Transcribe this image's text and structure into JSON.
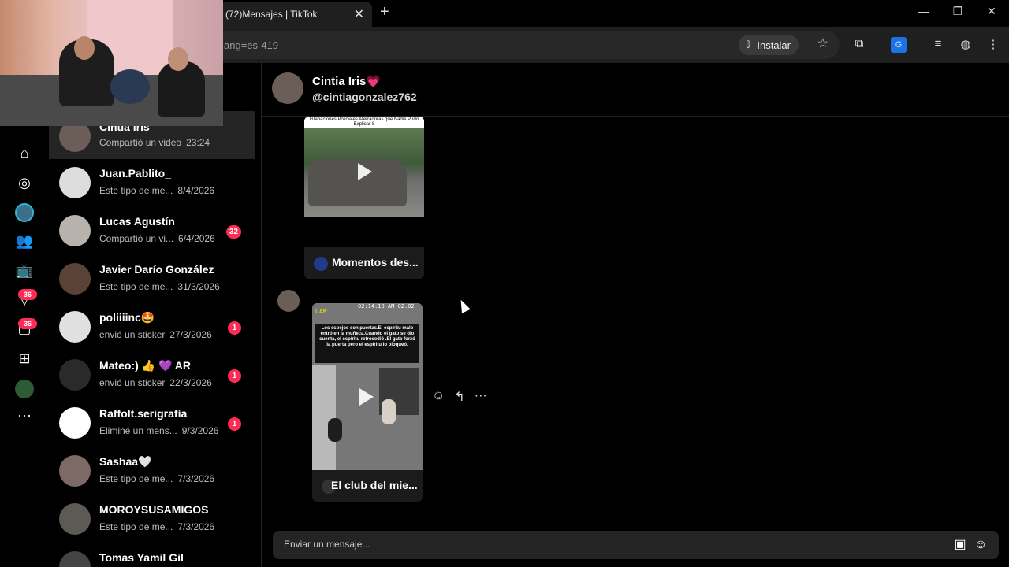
{
  "browser": {
    "tab_title": "(72)Mensajes | TikTok",
    "url": "ang=es-419",
    "install_label": "Instalar"
  },
  "rail": {
    "notifications_badge": "36",
    "messages_badge": "36"
  },
  "conversations": [
    {
      "name": "Cintia Iris",
      "preview": "Compartió un video",
      "date": "23:24",
      "unread": ""
    },
    {
      "name": "Juan.Pablito_",
      "preview": "Este tipo de me...",
      "date": "8/4/2026",
      "unread": ""
    },
    {
      "name": "Lucas Agustín",
      "preview": "Compartió un vi...",
      "date": "6/4/2026",
      "unread": "32"
    },
    {
      "name": "Javier Darío González",
      "preview": "Este tipo de me...",
      "date": "31/3/2026",
      "unread": ""
    },
    {
      "name": "poliiiinc🤩",
      "preview": "envió un sticker",
      "date": "27/3/2026",
      "unread": "1"
    },
    {
      "name": "Mateo:) 👍 💜 AR",
      "preview": "envió un sticker",
      "date": "22/3/2026",
      "unread": "1"
    },
    {
      "name": "Raffolt.serigrafía",
      "preview": "Eliminé un mens...",
      "date": "9/3/2026",
      "unread": "1"
    },
    {
      "name": "Sashaa🤍",
      "preview": "Este tipo de me...",
      "date": "7/3/2026",
      "unread": ""
    },
    {
      "name": "MOROYSUSAMIGOS",
      "preview": "Este tipo de me...",
      "date": "7/3/2026",
      "unread": ""
    },
    {
      "name": "Tomas Yamil Gil",
      "preview": "",
      "date": "",
      "unread": ""
    }
  ],
  "chat": {
    "name": "Cintia Iris💗",
    "handle": "@cintiagonzalez762",
    "video1_caption": "Momentos des...",
    "video1_overlay": "Grabaciones Policiales Aterradoras que Nadie Pudo Explicar-8",
    "video2_caption": "El club del mie...",
    "video2_overlay": "Los espejos son puertas.El espíritu malo entró en la muñeca.Cuando el gato se dio cuenta, el espíritu retrocedió .El gato forzó la puerta pero el espíritu lo bloqueó.",
    "video2_cam": "CAM",
    "video2_timestamp": "02:14:10 AM 02.02",
    "composer_placeholder": "Enviar un mensaje..."
  }
}
